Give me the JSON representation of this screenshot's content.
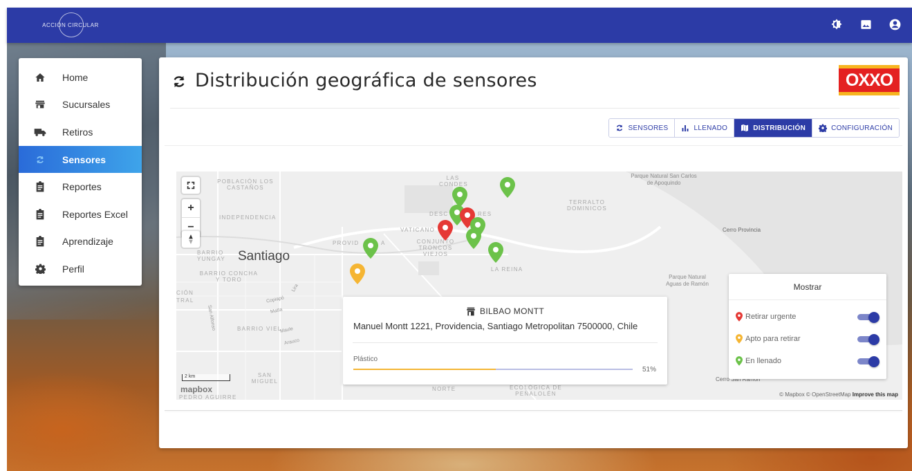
{
  "app": {
    "logo_text": "ACCIÓN CIRCULAR"
  },
  "topbar_icons": [
    "brightness-icon",
    "image-icon",
    "user-circle-icon"
  ],
  "sidebar": {
    "items": [
      {
        "label": "Home",
        "icon": "home-icon"
      },
      {
        "label": "Sucursales",
        "icon": "store-icon"
      },
      {
        "label": "Retiros",
        "icon": "truck-icon"
      },
      {
        "label": "Sensores",
        "icon": "sync-icon",
        "active": true
      },
      {
        "label": "Reportes",
        "icon": "clipboard-icon"
      },
      {
        "label": "Reportes Excel",
        "icon": "clipboard-icon"
      },
      {
        "label": "Aprendizaje",
        "icon": "clipboard-icon"
      },
      {
        "label": "Perfil",
        "icon": "gear-icon"
      }
    ]
  },
  "page": {
    "title": "Distribución geográfica de sensores",
    "brand_logo": "OXXO"
  },
  "tabs": [
    {
      "label": "SENSORES",
      "icon": "sync-icon"
    },
    {
      "label": "LLENADO",
      "icon": "bar-chart-icon"
    },
    {
      "label": "DISTRIBUCIÓN",
      "icon": "map-icon",
      "active": true
    },
    {
      "label": "CONFIGURACIÓN",
      "icon": "gear-icon"
    }
  ],
  "map": {
    "labels": {
      "poblacion": "POBLACIÓN LOS CASTAÑOS",
      "independencia": "INDEPENDENCIA",
      "barrio_yungay": "BARRIO YUNGAY",
      "santiago": "Santiago",
      "barrio_concha": "BARRIO CONCHA Y TORO",
      "las_condes": "LAS CONDES",
      "desc": "DESC",
      "res": "RES",
      "vaticano": "VATICANO",
      "providencia_a": "PROVID",
      "providencia_b": "A",
      "conjunto": "CONJUNTO TRONCOS VIEJOS",
      "la_reina": "LA REINA",
      "terralto": "TERRALTO DOMINICOS",
      "parque_san_carlos": "Parque Natural San Carlos de Apoquindo",
      "cerro_provincia": "Cerro Provincia",
      "parque_aguas": "Parque Natural Aguas de Ramón",
      "cerro_san_ramon": "Cerro San Ramón",
      "barrio_viel": "BARRIO VIEL",
      "san_miguel": "SAN MIGUEL",
      "pedro_aguirre": "PEDRO AGUIRRE",
      "ecologica": "ECOLÓGICA DE PEÑALOLÉN",
      "norte": "NORTE",
      "cion": "CIÓN",
      "tral": "TRAL",
      "street_lira": "Lira",
      "street_copiapo": "Copiapó",
      "street_matta": "Matta",
      "street_maule": "Maule",
      "street_arauco": "Arauco",
      "street_san_alfonso": "San Alfonso"
    },
    "scale_label": "2 km",
    "mapbox_label": "mapbox",
    "attribution": "© Mapbox © OpenStreetMap",
    "attribution_link": "Improve this map",
    "popup": {
      "title": "BILBAO MONTT",
      "address": "Manuel Montt 1221, Providencia, Santiago Metropolitan 7500000, Chile",
      "material": "Plástico",
      "fill_percent": 51,
      "fill_label": "51%"
    },
    "legend": {
      "title": "Mostrar",
      "items": [
        {
          "label": "Retirar urgente",
          "color": "#e53935",
          "on": true
        },
        {
          "label": "Apto para retirar",
          "color": "#f5b533",
          "on": true
        },
        {
          "label": "En llenado",
          "color": "#6cc24a",
          "on": true
        }
      ]
    },
    "pin_colors": {
      "red": "#e53935",
      "orange": "#f5b533",
      "green": "#6cc24a"
    }
  },
  "colors": {
    "primary": "#2c3ba6",
    "active_nav": "#3ea4ea"
  }
}
